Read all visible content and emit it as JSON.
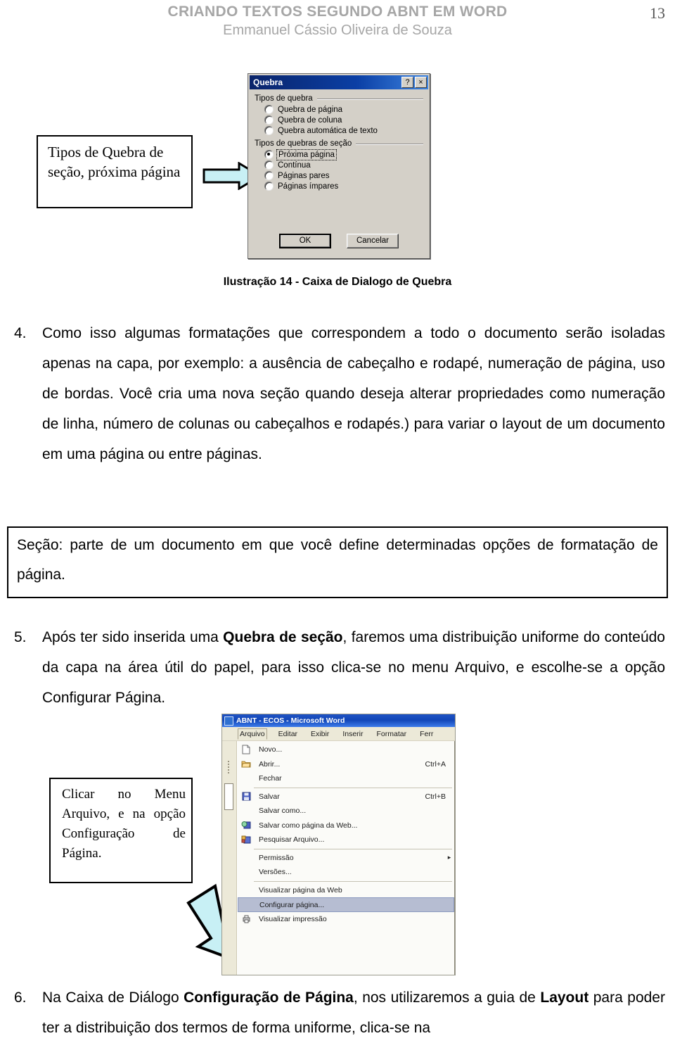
{
  "header": {
    "title": "CRIANDO TEXTOS SEGUNDO ABNT EM WORD",
    "author": "Emmanuel Cássio Oliveira de Souza",
    "page_number": "13",
    "color": "#a6a6a6"
  },
  "figure1": {
    "dialog": {
      "title": "Quebra",
      "help_button": "?",
      "close_button": "×",
      "group1_label": "Tipos de quebra",
      "group1_options": [
        {
          "label": "Quebra de página",
          "accel": "Q",
          "selected": false
        },
        {
          "label": "Quebra de coluna",
          "accel": "u",
          "selected": false
        },
        {
          "label": "Quebra automática de texto",
          "accel": "a",
          "selected": false
        }
      ],
      "group2_label": "Tipos de quebras de seção",
      "group2_options": [
        {
          "label": "Próxima página",
          "accel": "P",
          "selected": true,
          "focused": true
        },
        {
          "label": "Contínua",
          "accel": "C",
          "selected": false
        },
        {
          "label": "Páginas pares",
          "accel": "s",
          "selected": false
        },
        {
          "label": "Páginas ímpares",
          "accel": "m",
          "selected": false
        }
      ],
      "ok_button": "OK",
      "cancel_button": "Cancelar"
    },
    "callout": "Tipos de Quebra de seção, próxima página",
    "arrow": "right-arrow-callout",
    "caption": "Ilustração 14 - Caixa de Dialogo de Quebra"
  },
  "body": {
    "item4": {
      "number": "4.",
      "text": "Como isso algumas formatações que correspondem a todo o documento serão isoladas apenas na capa, por exemplo: a ausência de cabeçalho e rodapé, numeração de página, uso de bordas. Você cria uma nova seção quando deseja alterar propriedades como numeração de linha, número de colunas ou cabeçalhos e rodapés.) para variar o layout de um documento em uma página ou entre páginas."
    },
    "definition_box": {
      "text": "Seção: parte de um documento em que você define determinadas opções de formatação de página."
    },
    "item5": {
      "number": "5.",
      "prefix": "Após ter sido inserida uma ",
      "bold": "Quebra de seção",
      "suffix": ", faremos uma distribuição uniforme do conteúdo da capa na área útil do papel, para isso clica-se no menu Arquivo, e escolhe-se a opção Configurar Página."
    },
    "item6": {
      "number": "6.",
      "prefix": "Na Caixa de  Diálogo ",
      "bold1": "Configuração de Página",
      "middle": ", nos utilizaremos a guia de ",
      "bold2": "Layout",
      "suffix": " para poder ter a distribuição dos termos de forma uniforme, clica-se na"
    }
  },
  "figure2": {
    "callout": "Clicar no Menu Arquivo, e na opção Configuração de Página.",
    "arrow": "diagonal-arrow-callout",
    "window": {
      "title": "ABNT - ECOS - Microsoft Word",
      "menubar": [
        "Arquivo",
        "Editar",
        "Exibir",
        "Inserir",
        "Formatar",
        "Ferr"
      ],
      "menu_items": [
        {
          "label": "Novo...",
          "accel": "",
          "icon": "new-document-icon",
          "selected": false,
          "submenu": false
        },
        {
          "label": "Abrir...",
          "accel": "Ctrl+A",
          "icon": "open-folder-icon",
          "selected": false,
          "submenu": false
        },
        {
          "label": "Fechar",
          "accel": "",
          "icon": "",
          "selected": false,
          "submenu": false
        },
        {
          "sep": true
        },
        {
          "label": "Salvar",
          "accel": "Ctrl+B",
          "icon": "save-disk-icon",
          "selected": false,
          "submenu": false
        },
        {
          "label": "Salvar como...",
          "accel": "",
          "icon": "",
          "selected": false,
          "submenu": false
        },
        {
          "label": "Salvar como página da Web...",
          "accel": "",
          "icon": "save-web-icon",
          "selected": false,
          "submenu": false
        },
        {
          "label": "Pesquisar Arquivo...",
          "accel": "",
          "icon": "search-file-icon",
          "selected": false,
          "submenu": false
        },
        {
          "sep": true
        },
        {
          "label": "Permissão",
          "accel": "",
          "icon": "",
          "selected": false,
          "submenu": true
        },
        {
          "label": "Versões...",
          "accel": "",
          "icon": "",
          "selected": false,
          "submenu": false
        },
        {
          "sep": true
        },
        {
          "label": "Visualizar página da Web",
          "accel": "",
          "icon": "",
          "selected": false,
          "submenu": false
        },
        {
          "label": "Configurar página...",
          "accel": "",
          "icon": "",
          "selected": true,
          "submenu": false
        },
        {
          "label": "Visualizar impressão",
          "accel": "",
          "icon": "print-preview-icon",
          "selected": false,
          "submenu": false
        }
      ]
    }
  }
}
